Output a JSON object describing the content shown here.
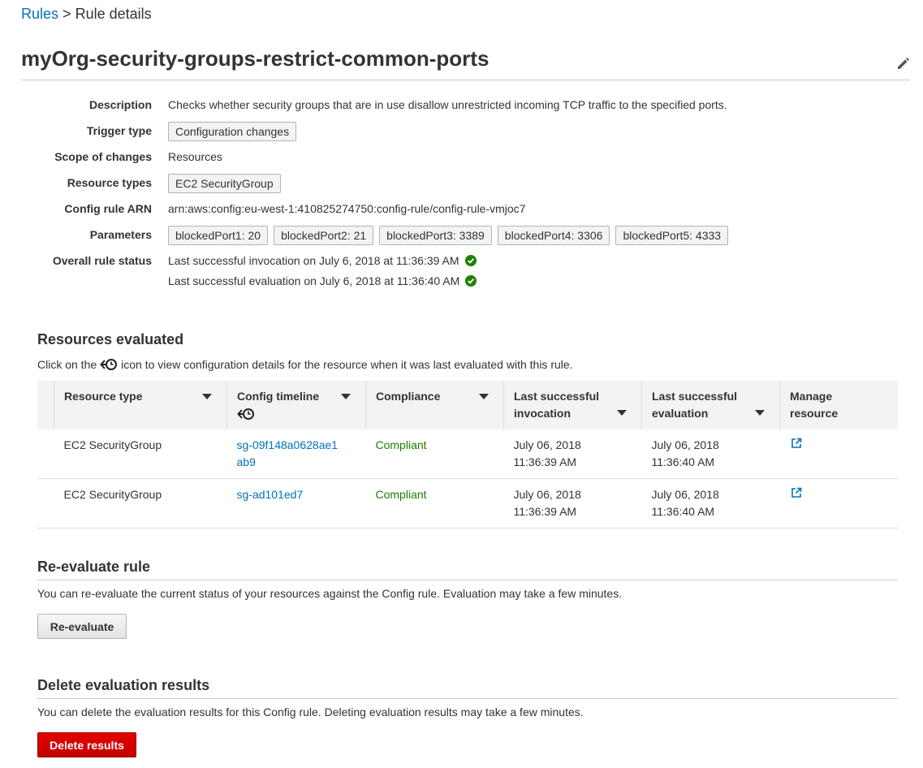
{
  "breadcrumb": {
    "parent": "Rules",
    "separator": ">",
    "current": "Rule details"
  },
  "title": "myOrg-security-groups-restrict-common-ports",
  "details": {
    "description_label": "Description",
    "description": "Checks whether security groups that are in use disallow unrestricted incoming TCP traffic to the specified ports.",
    "trigger_label": "Trigger type",
    "trigger": "Configuration changes",
    "scope_label": "Scope of changes",
    "scope": "Resources",
    "resource_types_label": "Resource types",
    "resource_type": "EC2 SecurityGroup",
    "arn_label": "Config rule ARN",
    "arn": "arn:aws:config:eu-west-1:410825274750:config-rule/config-rule-vmjoc7",
    "parameters_label": "Parameters",
    "parameters": [
      "blockedPort1: 20",
      "blockedPort2: 21",
      "blockedPort3: 3389",
      "blockedPort4: 3306",
      "blockedPort5: 4333"
    ],
    "status_label": "Overall rule status",
    "status_invocation": "Last successful invocation on July 6, 2018 at 11:36:39 AM",
    "status_evaluation": "Last successful evaluation on July 6, 2018 at 11:36:40 AM"
  },
  "resources": {
    "heading": "Resources evaluated",
    "hint_before": "Click on the",
    "hint_after": "icon to view configuration details for the resource when it was last evaluated with this rule.",
    "columns": [
      "Resource type",
      "Config timeline",
      "Compliance",
      "Last successful invocation",
      "Last successful evaluation",
      "Manage resource"
    ],
    "rows": [
      {
        "type": "EC2 SecurityGroup",
        "id": "sg-09f148a0628ae1ab9",
        "compliance": "Compliant",
        "invocation_date": "July 06, 2018",
        "invocation_time": "11:36:39 AM",
        "evaluation_date": "July 06, 2018",
        "evaluation_time": "11:36:40 AM"
      },
      {
        "type": "EC2 SecurityGroup",
        "id": "sg-ad101ed7",
        "compliance": "Compliant",
        "invocation_date": "July 06, 2018",
        "invocation_time": "11:36:39 AM",
        "evaluation_date": "July 06, 2018",
        "evaluation_time": "11:36:40 AM"
      }
    ]
  },
  "reevaluate": {
    "heading": "Re-evaluate rule",
    "text": "You can re-evaluate the current status of your resources against the Config rule. Evaluation may take a few minutes.",
    "button": "Re-evaluate"
  },
  "delete": {
    "heading": "Delete evaluation results",
    "text": "You can delete the evaluation results for this Config rule. Deleting evaluation results may take a few minutes.",
    "button": "Delete results"
  },
  "colors": {
    "link": "#0073bb",
    "compliant": "#1d8102",
    "success_icon": "#1d8102",
    "danger": "#d40000"
  }
}
